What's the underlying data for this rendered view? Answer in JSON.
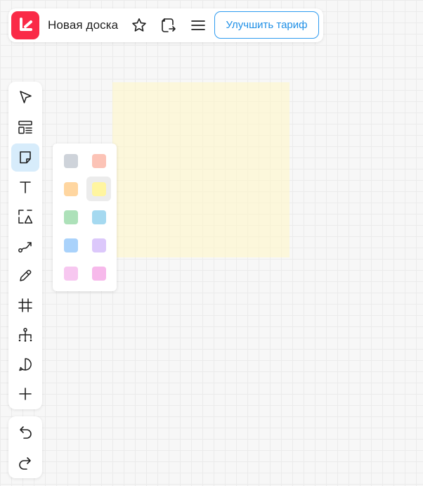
{
  "header": {
    "board_title": "Новая доска",
    "upgrade_label": "Улучшить тариф",
    "logo_color": "#fa2a47",
    "accent_color": "#1e8fe6"
  },
  "toolbar": {
    "tools": [
      {
        "name": "select",
        "icon": "cursor-arrow-icon"
      },
      {
        "name": "templates",
        "icon": "templates-icon"
      },
      {
        "name": "sticky-note",
        "icon": "sticky-note-icon",
        "active": true
      },
      {
        "name": "text",
        "icon": "text-icon"
      },
      {
        "name": "shapes",
        "icon": "shapes-icon"
      },
      {
        "name": "connector",
        "icon": "connector-line-icon"
      },
      {
        "name": "pen",
        "icon": "pen-icon"
      },
      {
        "name": "frame",
        "icon": "frame-icon"
      },
      {
        "name": "mind-map",
        "icon": "mind-map-icon"
      },
      {
        "name": "comment",
        "icon": "comment-icon"
      },
      {
        "name": "more",
        "icon": "plus-icon"
      }
    ],
    "history": [
      {
        "name": "undo",
        "icon": "undo-icon"
      },
      {
        "name": "redo",
        "icon": "redo-icon"
      }
    ]
  },
  "sticky_palette": {
    "selected_index": 3,
    "colors": [
      "#ced3da",
      "#fcc3b6",
      "#ffd6a0",
      "#fff5a0",
      "#ade1b9",
      "#a5d9f0",
      "#a9d2fb",
      "#dcc8fb",
      "#f7c7f0",
      "#f7b9eb"
    ],
    "preview_color": "#fff7c8"
  }
}
